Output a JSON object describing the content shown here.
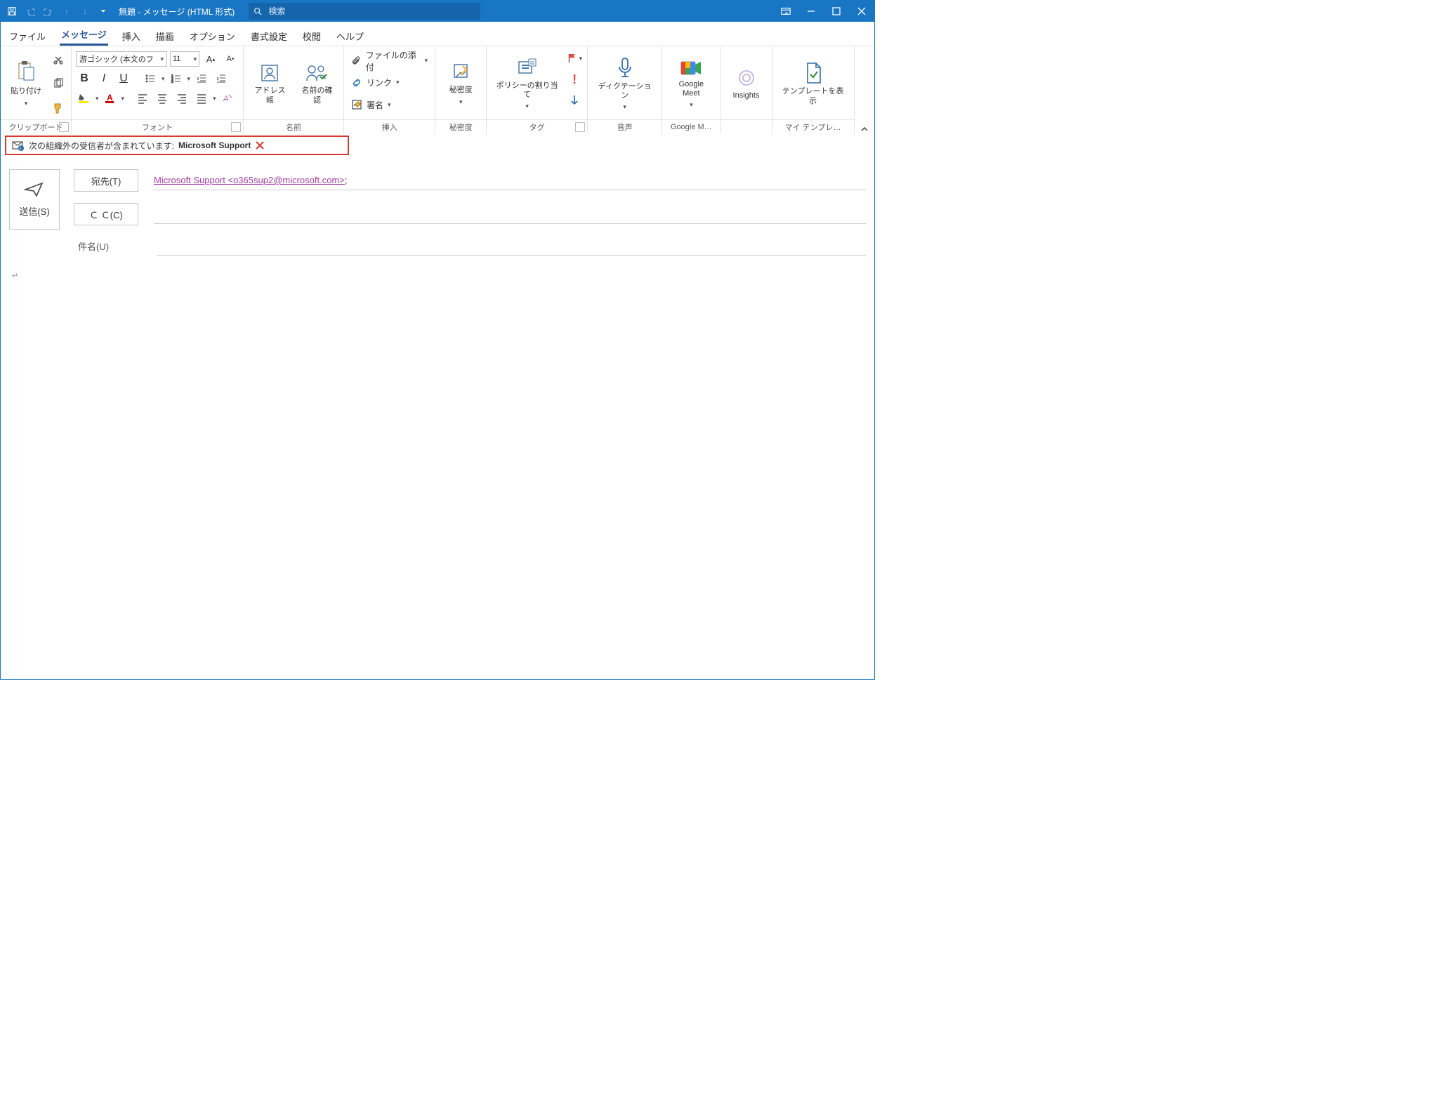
{
  "title": "無題  -  メッセージ (HTML 形式)",
  "search_placeholder": "検索",
  "tabs": [
    "ファイル",
    "メッセージ",
    "挿入",
    "描画",
    "オプション",
    "書式設定",
    "校閲",
    "ヘルプ"
  ],
  "active_tab": 1,
  "groups": {
    "clipboard": {
      "paste": "貼り付け",
      "label": "クリップボード"
    },
    "font": {
      "name": "游ゴシック (本文のフ",
      "size": "11",
      "label": "フォント"
    },
    "names": {
      "address_book": "アドレス帳",
      "check_names": "名前の確認",
      "label": "名前"
    },
    "include": {
      "attach_file": "ファイルの添付",
      "link": "リンク",
      "signature": "署名",
      "label": "挿入"
    },
    "sensitivity": {
      "button": "秘密度",
      "label": "秘密度"
    },
    "tags": {
      "policy": "ポリシーの割り当て",
      "label": "タグ"
    },
    "voice": {
      "dictation": "ディクテーション",
      "label": "音声"
    },
    "meet": {
      "button": "Google Meet",
      "label": "Google M…"
    },
    "insights": {
      "button": "Insights"
    },
    "template": {
      "button": "テンプレートを表示",
      "label": "マイ テンプレ…"
    }
  },
  "mailtip": {
    "prefix": "次の組織外の受信者が含まれています:",
    "recipient": "Microsoft Support"
  },
  "compose": {
    "send": "送信(S)",
    "to_label": "宛先(T)",
    "cc_label": "Ｃ Ｃ(C)",
    "subject_label": "件名(U)",
    "to_value": "Microsoft Support <o365sup2@microsoft.com>",
    "to_suffix": ";"
  },
  "body_marker": "↵"
}
